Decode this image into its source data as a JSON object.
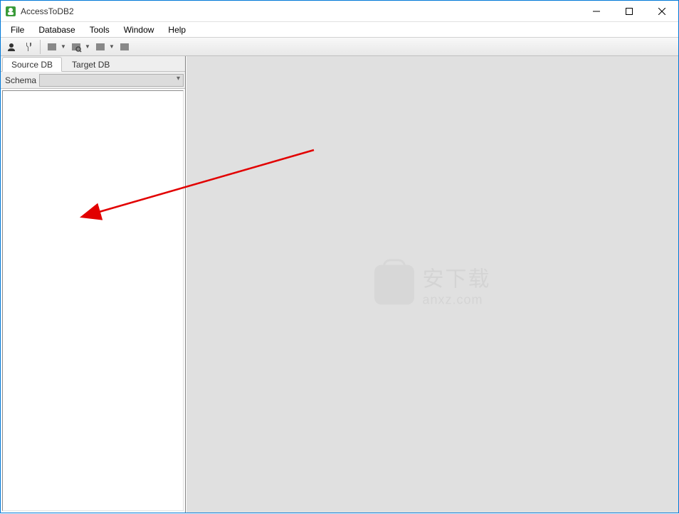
{
  "window": {
    "title": "AccessToDB2"
  },
  "menu": {
    "items": [
      "File",
      "Database",
      "Tools",
      "Window",
      "Help"
    ]
  },
  "toolbar": {
    "icons": [
      "head-icon",
      "pliers-icon",
      "sheet-icon",
      "query-icon",
      "block-icon",
      "block2-icon"
    ]
  },
  "leftPanel": {
    "tabs": [
      {
        "label": "Source DB",
        "active": true
      },
      {
        "label": "Target DB",
        "active": false
      }
    ],
    "schemaLabel": "Schema"
  },
  "watermark": {
    "cn": "安下载",
    "en": "anxz.com"
  }
}
